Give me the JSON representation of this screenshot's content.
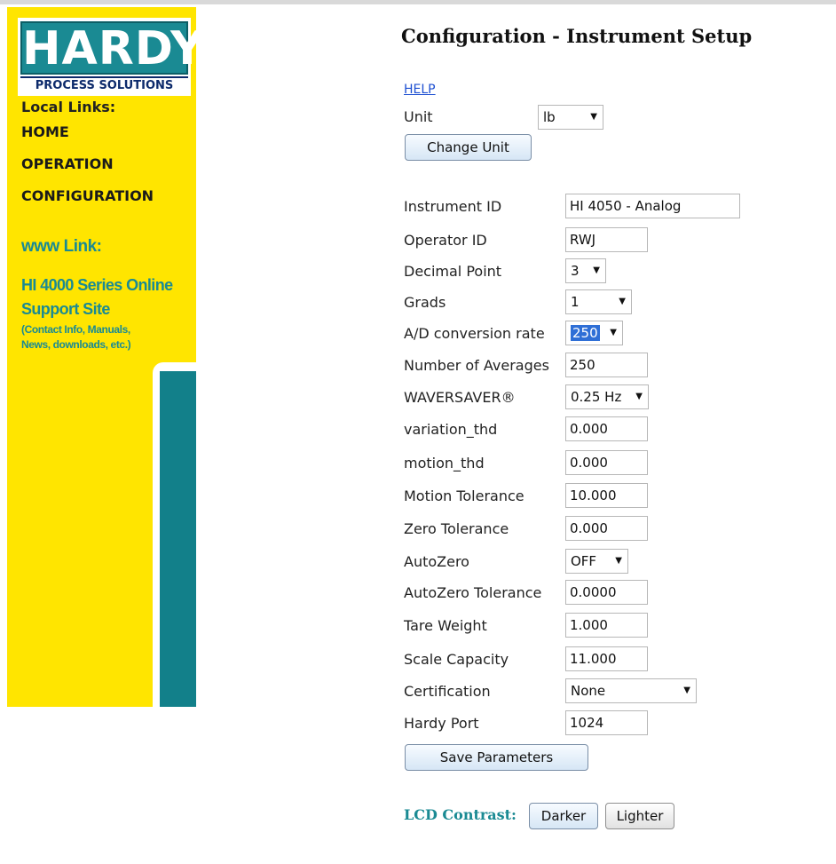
{
  "logo": {
    "brand": "HARDY",
    "tagline": "PROCESS SOLUTIONS"
  },
  "sidebar": {
    "local_links_title": "Local Links:",
    "links": [
      "HOME",
      "OPERATION",
      "CONFIGURATION"
    ],
    "www_title": "www Link:",
    "series_link": "HI 4000 Series Online Support Site",
    "series_note": "(Contact Info, Manuals, News, downloads, etc.)"
  },
  "page": {
    "title": "Configuration - Instrument Setup",
    "help": "HELP"
  },
  "unit": {
    "label": "Unit",
    "value": "lb",
    "change_button": "Change Unit"
  },
  "fields": {
    "instrument_id": {
      "label": "Instrument ID",
      "value": "HI 4050 - Analog"
    },
    "operator_id": {
      "label": "Operator ID",
      "value": "RWJ"
    },
    "decimal_point": {
      "label": "Decimal Point",
      "value": "3"
    },
    "grads": {
      "label": "Grads",
      "value": "1"
    },
    "ad_rate": {
      "label": "A/D conversion rate",
      "value": "250"
    },
    "num_averages": {
      "label": "Number of Averages",
      "value": "250"
    },
    "waversaver": {
      "label": "WAVERSAVER®",
      "value": "0.25 Hz"
    },
    "variation_thd": {
      "label": "variation_thd",
      "value": "0.000"
    },
    "motion_thd": {
      "label": "motion_thd",
      "value": "0.000"
    },
    "motion_tolerance": {
      "label": "Motion Tolerance",
      "value": "10.000"
    },
    "zero_tolerance": {
      "label": "Zero Tolerance",
      "value": "0.000"
    },
    "autozero": {
      "label": "AutoZero",
      "value": "OFF"
    },
    "autozero_tolerance": {
      "label": "AutoZero Tolerance",
      "value": "0.0000"
    },
    "tare_weight": {
      "label": "Tare Weight",
      "value": "1.000"
    },
    "scale_capacity": {
      "label": "Scale Capacity",
      "value": "11.000"
    },
    "certification": {
      "label": "Certification",
      "value": "None"
    },
    "hardy_port": {
      "label": "Hardy Port",
      "value": "1024"
    }
  },
  "save_button": "Save Parameters",
  "lcd": {
    "label": "LCD Contrast:",
    "darker": "Darker",
    "lighter": "Lighter"
  },
  "colors": {
    "sidebar_yellow": "#ffe500",
    "brand_teal": "#12808a",
    "link_blue": "#1d4fd1"
  }
}
